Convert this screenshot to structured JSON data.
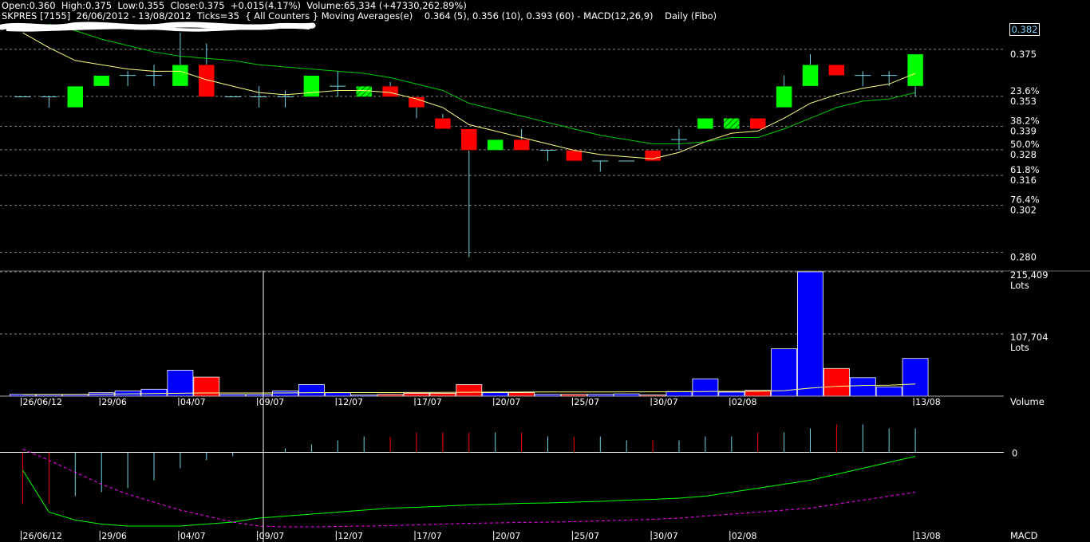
{
  "header": {
    "line1": "Open:0.360  High:0.375  Low:0.355  Close:0.375  +0.015(4.17%)  Volume:65,334 (+47330,262.89%)",
    "line2": "SKPRES [7155]  26/06/2012 - 13/08/2012  Ticks=35  { All Counters } Moving Averages(e)    0.364 (5), 0.356 (10), 0.393 (60) - MACD(12,26,9)    Daily (Fibo)"
  },
  "last_price_box": "0.382",
  "colors": {
    "bull": "#00ff00",
    "bear": "#ff0000",
    "flat": "#6fd6e8",
    "ma_short": "#ffff80",
    "ma_long": "#00cc00",
    "volume_bar": "#0000ff",
    "macd_line": "#00ff00",
    "signal_line": "#ff00ff"
  },
  "chart_data": [
    {
      "type": "candlestick",
      "title": "",
      "price_axis": [
        {
          "value": 0.375,
          "label": "0.375"
        },
        {
          "value": 0.353,
          "label": "0.353"
        },
        {
          "value": 0.339,
          "label": "0.339"
        },
        {
          "value": 0.328,
          "label": "0.328"
        },
        {
          "value": 0.316,
          "label": "0.316"
        },
        {
          "value": 0.302,
          "label": "0.302"
        },
        {
          "value": 0.28,
          "label": "0.280"
        }
      ],
      "fibo_levels": [
        {
          "value": 0.353,
          "label": "23.6%"
        },
        {
          "value": 0.339,
          "label": "38.2%"
        },
        {
          "value": 0.328,
          "label": "50.0%"
        },
        {
          "value": 0.316,
          "label": "61.8%"
        },
        {
          "value": 0.302,
          "label": "76.4%"
        }
      ],
      "ylim": [
        0.278,
        0.388
      ],
      "candles": [
        {
          "o": 0.355,
          "h": 0.355,
          "l": 0.355,
          "c": 0.355
        },
        {
          "o": 0.355,
          "h": 0.355,
          "l": 0.35,
          "c": 0.355
        },
        {
          "o": 0.35,
          "h": 0.36,
          "l": 0.35,
          "c": 0.36
        },
        {
          "o": 0.36,
          "h": 0.365,
          "l": 0.36,
          "c": 0.365
        },
        {
          "o": 0.365,
          "h": 0.367,
          "l": 0.36,
          "c": 0.365
        },
        {
          "o": 0.365,
          "h": 0.37,
          "l": 0.36,
          "c": 0.365
        },
        {
          "o": 0.36,
          "h": 0.385,
          "l": 0.36,
          "c": 0.37
        },
        {
          "o": 0.37,
          "h": 0.38,
          "l": 0.355,
          "c": 0.355
        },
        {
          "o": 0.355,
          "h": 0.355,
          "l": 0.355,
          "c": 0.355
        },
        {
          "o": 0.355,
          "h": 0.36,
          "l": 0.35,
          "c": 0.355
        },
        {
          "o": 0.355,
          "h": 0.358,
          "l": 0.35,
          "c": 0.355
        },
        {
          "o": 0.355,
          "h": 0.365,
          "l": 0.355,
          "c": 0.365
        },
        {
          "o": 0.36,
          "h": 0.367,
          "l": 0.355,
          "c": 0.36
        },
        {
          "o": 0.355,
          "h": 0.36,
          "l": 0.355,
          "c": 0.36,
          "hatched": true
        },
        {
          "o": 0.36,
          "h": 0.362,
          "l": 0.355,
          "c": 0.355
        },
        {
          "o": 0.355,
          "h": 0.355,
          "l": 0.345,
          "c": 0.35
        },
        {
          "o": 0.345,
          "h": 0.347,
          "l": 0.34,
          "c": 0.34
        },
        {
          "o": 0.34,
          "h": 0.34,
          "l": 0.28,
          "c": 0.33
        },
        {
          "o": 0.33,
          "h": 0.335,
          "l": 0.33,
          "c": 0.335
        },
        {
          "o": 0.335,
          "h": 0.34,
          "l": 0.33,
          "c": 0.33
        },
        {
          "o": 0.33,
          "h": 0.33,
          "l": 0.325,
          "c": 0.33
        },
        {
          "o": 0.33,
          "h": 0.33,
          "l": 0.325,
          "c": 0.325
        },
        {
          "o": 0.325,
          "h": 0.325,
          "l": 0.32,
          "c": 0.325
        },
        {
          "o": 0.325,
          "h": 0.325,
          "l": 0.325,
          "c": 0.325
        },
        {
          "o": 0.33,
          "h": 0.33,
          "l": 0.325,
          "c": 0.325
        },
        {
          "o": 0.335,
          "h": 0.34,
          "l": 0.33,
          "c": 0.335
        },
        {
          "o": 0.34,
          "h": 0.345,
          "l": 0.34,
          "c": 0.345
        },
        {
          "o": 0.34,
          "h": 0.345,
          "l": 0.34,
          "c": 0.345,
          "hatched": true
        },
        {
          "o": 0.345,
          "h": 0.345,
          "l": 0.34,
          "c": 0.34
        },
        {
          "o": 0.35,
          "h": 0.365,
          "l": 0.35,
          "c": 0.36
        },
        {
          "o": 0.36,
          "h": 0.375,
          "l": 0.36,
          "c": 0.37
        },
        {
          "o": 0.37,
          "h": 0.37,
          "l": 0.365,
          "c": 0.365,
          "hatched": true
        },
        {
          "o": 0.365,
          "h": 0.367,
          "l": 0.36,
          "c": 0.365
        },
        {
          "o": 0.365,
          "h": 0.367,
          "l": 0.36,
          "c": 0.365
        },
        {
          "o": 0.36,
          "h": 0.375,
          "l": 0.355,
          "c": 0.375
        }
      ],
      "ma_short": [
        0.385,
        0.378,
        0.372,
        0.37,
        0.368,
        0.367,
        0.367,
        0.363,
        0.36,
        0.357,
        0.356,
        0.357,
        0.358,
        0.358,
        0.357,
        0.354,
        0.35,
        0.342,
        0.339,
        0.336,
        0.333,
        0.33,
        0.328,
        0.327,
        0.326,
        0.329,
        0.334,
        0.338,
        0.339,
        0.345,
        0.352,
        0.356,
        0.359,
        0.361,
        0.366
      ],
      "ma_long": [
        null,
        0.389,
        0.386,
        0.382,
        0.379,
        0.376,
        0.374,
        0.373,
        0.372,
        0.37,
        0.369,
        0.368,
        0.367,
        0.366,
        0.364,
        0.361,
        0.358,
        0.352,
        0.349,
        0.346,
        0.343,
        0.34,
        0.337,
        0.335,
        0.333,
        0.333,
        0.334,
        0.336,
        0.336,
        0.34,
        0.345,
        0.35,
        0.353,
        0.354,
        0.357
      ]
    },
    {
      "type": "bar",
      "title": "",
      "label": "Volume",
      "axis_ticks": [
        {
          "value": 215409,
          "label": "215,409",
          "unit": "Lots"
        },
        {
          "value": 107704,
          "label": "107,704",
          "unit": "Lots"
        }
      ],
      "ylim": [
        0,
        215409
      ],
      "values": [
        3000,
        3000,
        3000,
        6000,
        9000,
        12000,
        45000,
        33000,
        3000,
        3000,
        9000,
        20000,
        6000,
        2000,
        3000,
        5000,
        5000,
        20000,
        6000,
        6000,
        3000,
        3000,
        3000,
        4000,
        2000,
        8000,
        30000,
        7000,
        10000,
        82000,
        215409,
        48000,
        32000,
        16000,
        65334
      ],
      "ma": [
        3000,
        3000,
        3000,
        3500,
        4000,
        4500,
        5000,
        5500,
        5500,
        5500,
        5600,
        6000,
        6200,
        6200,
        6300,
        6400,
        6500,
        6800,
        7000,
        7100,
        7200,
        7200,
        7300,
        7400,
        7400,
        7600,
        8000,
        8200,
        8500,
        9500,
        14000,
        17000,
        18500,
        19000,
        21000
      ]
    },
    {
      "type": "macd",
      "title": "",
      "label": "MACD",
      "zero_label": "0",
      "ylim": [
        -0.0195,
        0.0095
      ],
      "histogram": [
        -0.013,
        -0.013,
        -0.011,
        -0.01,
        -0.009,
        -0.007,
        -0.004,
        -0.002,
        -0.001,
        0,
        0.001,
        0.002,
        0.003,
        0.004,
        0.004,
        0.005,
        0.005,
        0.005,
        0.005,
        0.005,
        0.004,
        0.004,
        0.004,
        0.003,
        0.003,
        0.003,
        0.004,
        0.004,
        0.005,
        0.005,
        0.006,
        0.007,
        0.007,
        0.006,
        0.006
      ],
      "macd": [
        -0.0045,
        -0.015,
        -0.017,
        -0.018,
        -0.0185,
        -0.0185,
        -0.0185,
        -0.018,
        -0.0175,
        -0.0165,
        -0.016,
        -0.0155,
        -0.015,
        -0.0145,
        -0.014,
        -0.0138,
        -0.0135,
        -0.0132,
        -0.013,
        -0.0128,
        -0.0127,
        -0.0125,
        -0.0123,
        -0.012,
        -0.0118,
        -0.0115,
        -0.011,
        -0.01,
        -0.009,
        -0.008,
        -0.007,
        -0.0055,
        -0.004,
        -0.0025,
        -0.001
      ],
      "signal": [
        0.0008,
        -0.002,
        -0.005,
        -0.008,
        -0.0105,
        -0.0125,
        -0.0145,
        -0.016,
        -0.0175,
        -0.0185,
        -0.0187,
        -0.0187,
        -0.0186,
        -0.0185,
        -0.0184,
        -0.0182,
        -0.018,
        -0.0178,
        -0.0177,
        -0.0176,
        -0.0175,
        -0.0174,
        -0.0172,
        -0.017,
        -0.0168,
        -0.0165,
        -0.016,
        -0.0155,
        -0.015,
        -0.0145,
        -0.014,
        -0.013,
        -0.012,
        -0.011,
        -0.01
      ]
    }
  ],
  "x_axis_labels": [
    {
      "index": 0,
      "label": "26/06/12"
    },
    {
      "index": 3,
      "label": "29/06"
    },
    {
      "index": 6,
      "label": "04/07"
    },
    {
      "index": 9,
      "label": "09/07"
    },
    {
      "index": 12,
      "label": "12/07"
    },
    {
      "index": 15,
      "label": "17/07"
    },
    {
      "index": 18,
      "label": "20/07"
    },
    {
      "index": 21,
      "label": "25/07"
    },
    {
      "index": 24,
      "label": "30/07"
    },
    {
      "index": 27,
      "label": "02/08"
    },
    {
      "index": 34,
      "label": "13/08"
    }
  ]
}
